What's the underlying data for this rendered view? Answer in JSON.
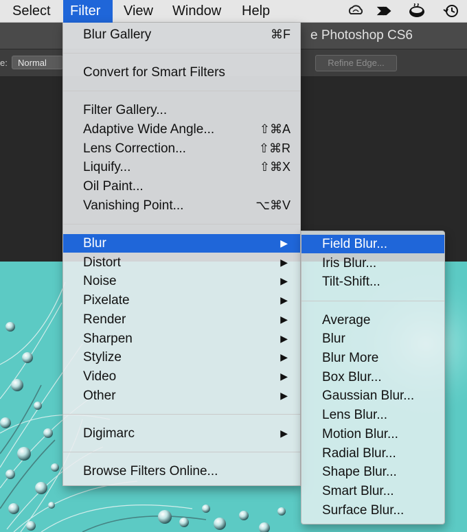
{
  "menubar": {
    "items": [
      {
        "label": "Select"
      },
      {
        "label": "Filter"
      },
      {
        "label": "View"
      },
      {
        "label": "Window"
      },
      {
        "label": "Help"
      }
    ],
    "tray_icons": [
      "creative-cloud-icon",
      "arrow-app-icon",
      "coffee-cup-icon",
      "time-machine-icon"
    ]
  },
  "app": {
    "title": "e Photoshop CS6",
    "options_label": "e:",
    "mode_select": "Normal",
    "refine_edge": "Refine Edge..."
  },
  "filter_menu": {
    "blur_gallery": {
      "label": "Blur Gallery",
      "shortcut": "⌘F"
    },
    "convert_smart": {
      "label": "Convert for Smart Filters"
    },
    "filter_gallery": {
      "label": "Filter Gallery..."
    },
    "adaptive_wide": {
      "label": "Adaptive Wide Angle...",
      "shortcut": "⇧⌘A"
    },
    "lens_correction": {
      "label": "Lens Correction...",
      "shortcut": "⇧⌘R"
    },
    "liquify": {
      "label": "Liquify...",
      "shortcut": "⇧⌘X"
    },
    "oil_paint": {
      "label": "Oil Paint..."
    },
    "vanishing_point": {
      "label": "Vanishing Point...",
      "shortcut": "⌥⌘V"
    },
    "blur": {
      "label": "Blur"
    },
    "distort": {
      "label": "Distort"
    },
    "noise": {
      "label": "Noise"
    },
    "pixelate": {
      "label": "Pixelate"
    },
    "render": {
      "label": "Render"
    },
    "sharpen": {
      "label": "Sharpen"
    },
    "stylize": {
      "label": "Stylize"
    },
    "video": {
      "label": "Video"
    },
    "other": {
      "label": "Other"
    },
    "digimarc": {
      "label": "Digimarc"
    },
    "browse_online": {
      "label": "Browse Filters Online..."
    },
    "submenu_arrow": "▶"
  },
  "blur_submenu": {
    "field_blur": "Field Blur...",
    "iris_blur": "Iris Blur...",
    "tilt_shift": "Tilt-Shift...",
    "average": "Average",
    "blur": "Blur",
    "blur_more": "Blur More",
    "box_blur": "Box Blur...",
    "gaussian_blur": "Gaussian Blur...",
    "lens_blur": "Lens Blur...",
    "motion_blur": "Motion Blur...",
    "radial_blur": "Radial Blur...",
    "shape_blur": "Shape Blur...",
    "smart_blur": "Smart Blur...",
    "surface_blur": "Surface Blur..."
  },
  "colors": {
    "highlight": "#1f66d9",
    "canvas": "#5ccac4"
  }
}
